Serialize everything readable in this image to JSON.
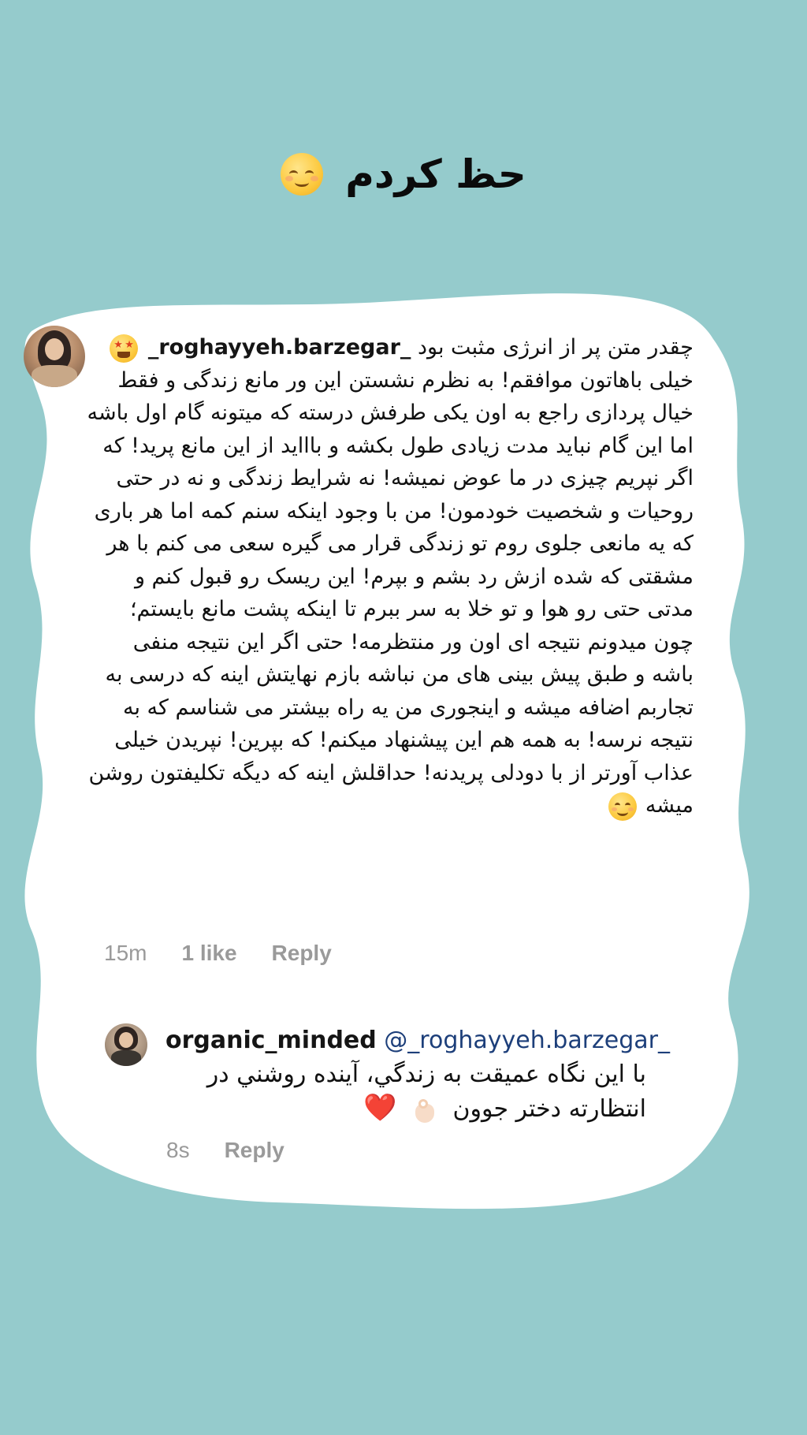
{
  "story": {
    "caption": "حظ کردم",
    "caption_emoji": "relieved-face-emoji",
    "background_color": "#95cbcc"
  },
  "comment": {
    "username": "_roghayyeh.barzegar_",
    "text_before_emoji": "چقدر متن پر از انرژی مثبت بود",
    "text_main": "خیلی باهاتون موافقم! به نظرم نشستن این ور مانع زندگی و فقط خیال پردازی راجع به اون یکی طرفش درسته که میتونه گام اول باشه اما این گام نباید مدت زیادی طول بکشه و باااید از این مانع پرید! که اگر نپریم چیزی در ما عوض نمیشه! نه شرایط زندگی و نه در حتی روحیات و شخصیت خودمون! من با وجود اینکه سنم کمه اما هر باری که یه مانعی جلوی روم تو زندگی قرار می گیره سعی می کنم با هر مشقتی که شده ازش رد بشم و بپرم! این ریسک رو قبول کنم و مدتی حتی رو هوا و تو خلا به سر ببرم تا اینکه پشت مانع بایستم؛ چون میدونم نتیجه ای اون ور منتظرمه! حتی اگر این نتیجه منفی باشه و طبق پیش بینی های من نباشه بازم نهایتش اینه که درسی به تجاربم اضافه میشه و اینجوری من یه راه بیشتر می شناسم که به نتیجه نرسه! به همه هم این پیشنهاد میکنم! که بپرین! نپریدن خیلی عذاب آورتر از با دودلی پریدنه! حداقلش اینه که دیگه تکلیفتون روشن میشه",
    "emoji_1": "star-struck-emoji",
    "emoji_2": "smiling-face-emoji",
    "time": "15m",
    "likes": "1 like",
    "reply_label": "Reply"
  },
  "reply": {
    "username": "organic_minded",
    "mention": "@_roghayyeh.barzegar_",
    "text": "با این نگاه عمیقت به زندگي، آینده روشني در انتظارته دختر جوون",
    "heart": "❤️",
    "ok_hand_emoji": "ok-hand-emoji",
    "time": "8s",
    "reply_label": "Reply"
  }
}
